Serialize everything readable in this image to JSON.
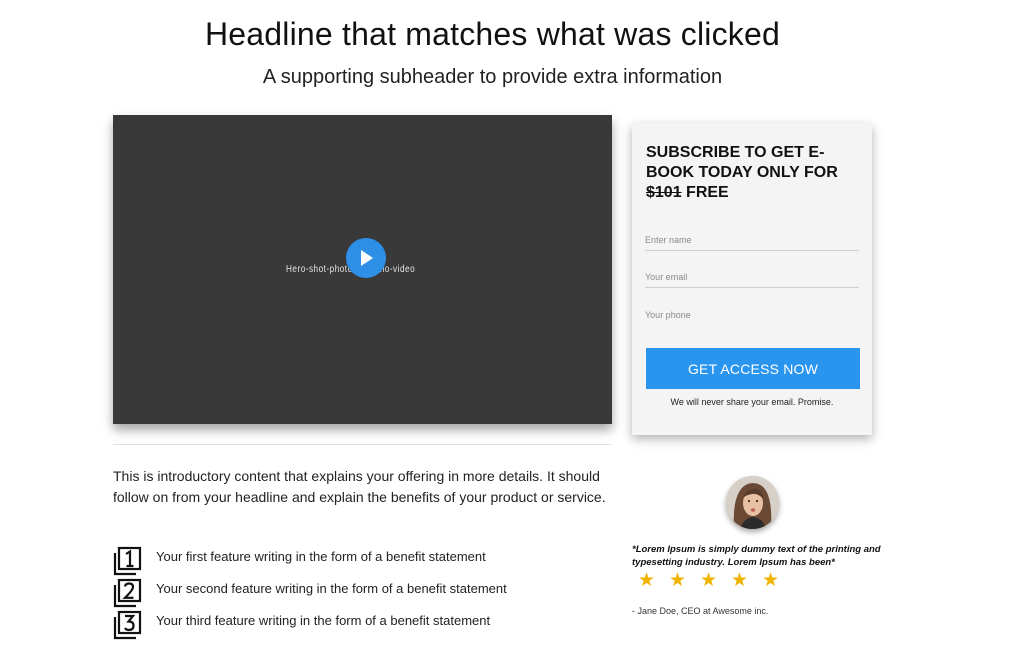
{
  "header": {
    "headline": "Headline that matches what was clicked",
    "subheader": "A supporting subheader to provide extra information"
  },
  "video": {
    "label": "Hero-shot-photo-or-demo-video",
    "play_icon": "play-icon",
    "accent": "#2d8fe6"
  },
  "form": {
    "title_prefix": "SUBSCRIBE TO GET E-BOOK TODAY ONLY FOR",
    "price": "$101",
    "title_suffix": "FREE",
    "name_placeholder": "Enter name",
    "email_placeholder": "Your email",
    "phone_placeholder": "Your phone",
    "button_label": "GET ACCESS NOW",
    "privacy_note": "We will never share your email. Promise.",
    "button_color": "#2a95ef"
  },
  "intro": {
    "text": "This is introductory content that explains your offering in more details. It should follow on from your headline and explain the benefits of your product or service."
  },
  "features": [
    {
      "number": "1",
      "icon": "number-1-icon",
      "text": "Your first feature writing in the form of a benefit statement"
    },
    {
      "number": "2",
      "icon": "number-2-icon",
      "text": "Your second feature writing in the form of a benefit statement"
    },
    {
      "number": "3",
      "icon": "number-3-icon",
      "text": "Your third feature writing in the form of a benefit statement"
    }
  ],
  "testimonial": {
    "quote": "*Lorem Ipsum is simply dummy text of the printing and typesetting industry. Lorem Ipsum has been*",
    "rating": 5,
    "rating_max": 5,
    "star_glyph": "★",
    "author": "- Jane Doe, CEO at Awesome inc.",
    "star_color": "#f0b400"
  }
}
